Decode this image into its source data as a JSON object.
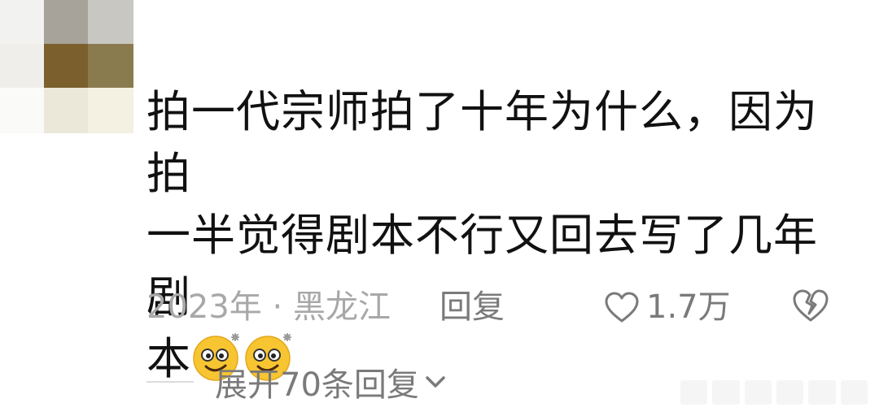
{
  "comment": {
    "text_line1": "拍一代宗师拍了十年为什么，因为拍",
    "text_line2": "一半觉得剧本不行又回去写了几年剧",
    "text_line3": "本",
    "emoji_name": "dazed-face-emoji",
    "emoji_count": 2
  },
  "meta": {
    "date_location": "2023年 · 黑龙江",
    "reply_label": "回复",
    "like_count": "1.7万"
  },
  "expand": {
    "label": "展开70条回复"
  },
  "colors": {
    "text": "#111111",
    "secondary": "#7a7a7a",
    "muted": "#a8a8a8",
    "emoji_face": "#f7c531"
  }
}
